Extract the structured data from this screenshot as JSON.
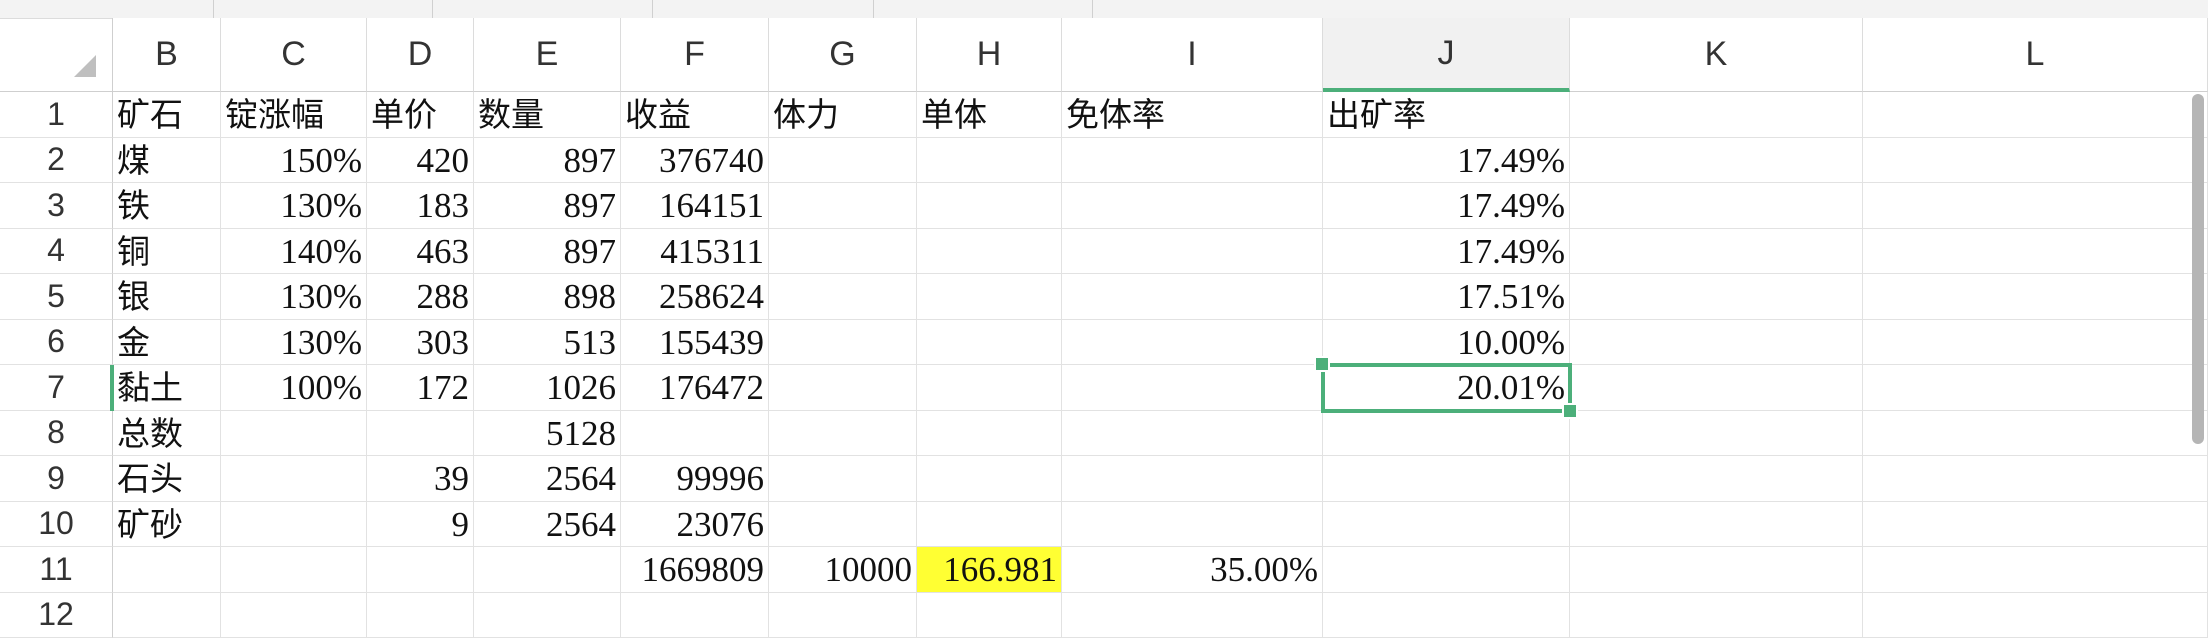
{
  "columns": [
    "B",
    "C",
    "D",
    "E",
    "F",
    "G",
    "H",
    "I",
    "J",
    "K",
    "L"
  ],
  "active_column": "J",
  "rows": [
    {
      "n": "1",
      "cells": {
        "B": "矿石",
        "C": "锭涨幅",
        "D": "单价",
        "E": "数量",
        "F": "收益",
        "G": "体力",
        "H": "单体",
        "I": "免体率",
        "J": "出矿率"
      }
    },
    {
      "n": "2",
      "cells": {
        "B": "煤",
        "C": "150%",
        "D": "420",
        "E": "897",
        "F": "376740",
        "J": "17.49%"
      }
    },
    {
      "n": "3",
      "cells": {
        "B": "铁",
        "C": "130%",
        "D": "183",
        "E": "897",
        "F": "164151",
        "J": "17.49%"
      }
    },
    {
      "n": "4",
      "cells": {
        "B": "铜",
        "C": "140%",
        "D": "463",
        "E": "897",
        "F": "415311",
        "J": "17.49%"
      }
    },
    {
      "n": "5",
      "cells": {
        "B": "银",
        "C": "130%",
        "D": "288",
        "E": "898",
        "F": "258624",
        "J": "17.51%"
      }
    },
    {
      "n": "6",
      "cells": {
        "B": "金",
        "C": "130%",
        "D": "303",
        "E": "513",
        "F": "155439",
        "J": "10.00%"
      }
    },
    {
      "n": "7",
      "cells": {
        "B": "黏土",
        "C": "100%",
        "D": "172",
        "E": "1026",
        "F": "176472",
        "J": "20.01%"
      }
    },
    {
      "n": "8",
      "cells": {
        "B": "总数",
        "E": "5128"
      }
    },
    {
      "n": "9",
      "cells": {
        "B": "石头",
        "D": "39",
        "E": "2564",
        "F": "99996"
      }
    },
    {
      "n": "10",
      "cells": {
        "B": "矿砂",
        "D": "9",
        "E": "2564",
        "F": "23076"
      }
    },
    {
      "n": "11",
      "cells": {
        "F": "1669809",
        "G": "10000",
        "H": "166.981",
        "I": "35.00%"
      }
    },
    {
      "n": "12",
      "cells": {}
    }
  ],
  "selected_cell": "J7",
  "colors": {
    "selection": "#4caf7a",
    "highlight": "#ffff33"
  }
}
